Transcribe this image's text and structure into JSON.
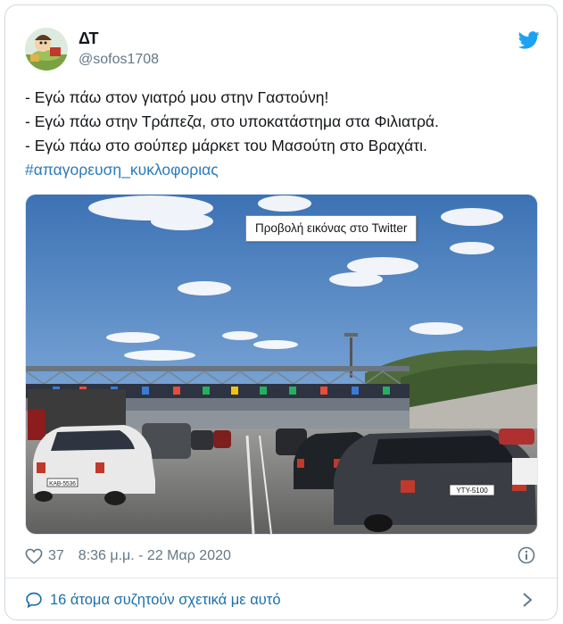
{
  "tweet": {
    "display_name": "ΔΤ",
    "handle": "@sofos1708",
    "lines": [
      "- Εγώ πάω στον γιατρό μου στην Γαστούνη!",
      "- Εγώ πάω στην Τράπεζα, στο υποκατάστημα στα Φιλιατρά.",
      "- Εγώ πάω στο σούπερ μάρκετ του Μασούτη στο Βραχάτι."
    ],
    "hashtag": "#απαγορευση_κυκλοφοριας",
    "media_tooltip": "Προβολή εικόνας στο Twitter",
    "plate_left": "ΚΑΒ-5536",
    "plate_right": "ΥΤΥ-5100",
    "likes": "37",
    "timestamp": "8:36 μ.μ. - 22 Μαρ 2020",
    "discussion": "16 άτομα συζητούν σχετικά με αυτό"
  },
  "colors": {
    "twitter_blue": "#1da1f2",
    "link_blue": "#2b7bb9",
    "muted": "#657786",
    "border": "#cfd9de"
  },
  "icons": {
    "brand": "twitter-bird-icon",
    "like": "heart-icon",
    "info": "info-icon",
    "reply": "speech-bubble-icon",
    "more": "chevron-right-icon"
  }
}
